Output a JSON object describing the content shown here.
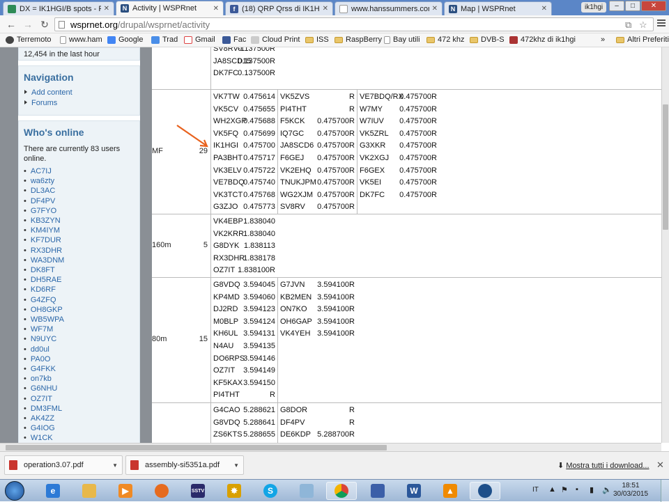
{
  "tabs": [
    {
      "title": "DX = IK1HGI/B spots - R",
      "favicon": "chart-favicon",
      "color": "#2e8b57",
      "active": false
    },
    {
      "title": "Activity | WSPRnet",
      "favicon": "n-favicon",
      "color": "#2b4f80",
      "active": true
    },
    {
      "title": "(18) QRP Qrss di IK1HGI",
      "favicon": "facebook-favicon",
      "color": "#3b5998",
      "active": false
    },
    {
      "title": "www.hanssummers.com/",
      "favicon": "page-favicon",
      "color": "#999999",
      "active": false
    },
    {
      "title": "Map | WSPRnet",
      "favicon": "n-favicon",
      "color": "#2b4f80",
      "active": false
    }
  ],
  "profile": "ik1hgi",
  "window_controls": {
    "minimize": "–",
    "maximize": "□",
    "close": "✕"
  },
  "url": {
    "host": "wsprnet.org",
    "path": "/drupal/wsprnet/activity"
  },
  "bookmarks": [
    {
      "label": "Terremoto",
      "icon": "app-icon"
    },
    {
      "label": "www.ham",
      "icon": "page-icon"
    },
    {
      "label": "Google",
      "icon": "google-icon"
    },
    {
      "label": "Trad",
      "icon": "translate-icon"
    },
    {
      "label": "Gmail",
      "icon": "gmail-icon"
    },
    {
      "label": "Fac",
      "icon": "facebook-icon"
    },
    {
      "label": "Cloud Print",
      "icon": "printer-icon"
    },
    {
      "label": "ISS",
      "icon": "folder-icon"
    },
    {
      "label": "RaspBerry",
      "icon": "folder-icon"
    },
    {
      "label": "Bay utili",
      "icon": "page-icon"
    },
    {
      "label": "472 khz",
      "icon": "folder-icon"
    },
    {
      "label": "DVB-S",
      "icon": "folder-icon"
    },
    {
      "label": "472khz di ik1hgi",
      "icon": "antenna-icon"
    }
  ],
  "bookmarks_more": "»",
  "other_bookmarks": "Altri Preferiti",
  "sidebar": {
    "stats_text": "12,454 in the last hour",
    "navigation": {
      "title": "Navigation",
      "items": [
        "Add content",
        "Forums"
      ]
    },
    "whos_online": {
      "title": "Who's online",
      "text": "There are currently 83 users online.",
      "users": [
        "AC7IJ",
        "wa6zty",
        "DL3AC",
        "DF4PV",
        "G7FYO",
        "KB3ZYN",
        "KM4IYM",
        "KF7DUR",
        "RX3DHR",
        "WA3DNM",
        "DK8FT",
        "DH5RAE",
        "KD6RF",
        "G4ZFQ",
        "OH8GKP",
        "WB5WPA",
        "WF7M",
        "N9UYC",
        "dd0ul",
        "PA0O",
        "G4FKK",
        "on7kb",
        "G6NHU",
        "OZ7IT",
        "DM3FML",
        "AK4ZZ",
        "G4IOG",
        "W1CK"
      ]
    }
  },
  "activity": {
    "top_partial": {
      "columns": [
        [
          [
            "SV8RV-1",
            "0.137500R"
          ],
          [
            "JA8SCD15",
            "0.137500R"
          ],
          [
            "DK7FC",
            "0.137500R"
          ]
        ]
      ]
    },
    "bands": [
      {
        "band": "MF",
        "count": "29",
        "columns": [
          [
            [
              "VK7TW",
              "0.475614"
            ],
            [
              "VK5CV",
              "0.475655"
            ],
            [
              "WH2XGP",
              "0.475688"
            ],
            [
              "VK5FQ",
              "0.475699"
            ],
            [
              "IK1HGI",
              "0.475700"
            ],
            [
              "PA3BHT",
              "0.475717"
            ],
            [
              "VK3ELV",
              "0.475722"
            ],
            [
              "VE7BDQ",
              "0.475740"
            ],
            [
              "VK3TCT",
              "0.475768"
            ],
            [
              "G3ZJO",
              "0.475773"
            ]
          ],
          [
            [
              "VK5ZVS",
              "R"
            ],
            [
              "PI4THT",
              "R"
            ],
            [
              "F5KCK",
              "0.475700R"
            ],
            [
              "IQ7GC",
              "0.475700R"
            ],
            [
              "JA8SCD6",
              "0.475700R"
            ],
            [
              "F6GEJ",
              "0.475700R"
            ],
            [
              "VK2EHQ",
              "0.475700R"
            ],
            [
              "TNUKJPM",
              "0.475700R"
            ],
            [
              "WG2XJM",
              "0.475700R"
            ],
            [
              "SV8RV",
              "0.475700R"
            ]
          ],
          [
            [
              "VE7BDQ/RX",
              "0.475700R"
            ],
            [
              "W7MY",
              "0.475700R"
            ],
            [
              "W7IUV",
              "0.475700R"
            ],
            [
              "VK5ZRL",
              "0.475700R"
            ],
            [
              "G3XKR",
              "0.475700R"
            ],
            [
              "VK2XGJ",
              "0.475700R"
            ],
            [
              "F6GEX",
              "0.475700R"
            ],
            [
              "VK5EI",
              "0.475700R"
            ],
            [
              "DK7FC",
              "0.475700R"
            ]
          ]
        ]
      },
      {
        "band": "160m",
        "count": "5",
        "columns": [
          [
            [
              "VK4EBP",
              "1.838040"
            ],
            [
              "VK2KRR",
              "1.838040"
            ],
            [
              "G8DYK",
              "1.838113"
            ],
            [
              "RX3DHR",
              "1.838178"
            ],
            [
              "OZ7IT",
              "1.838100R"
            ]
          ]
        ]
      },
      {
        "band": "80m",
        "count": "15",
        "columns": [
          [
            [
              "G8VDQ",
              "3.594045"
            ],
            [
              "KP4MD",
              "3.594060"
            ],
            [
              "DJ2RD",
              "3.594123"
            ],
            [
              "M0BLP",
              "3.594124"
            ],
            [
              "KH6UL",
              "3.594131"
            ],
            [
              "N4AU",
              "3.594135"
            ],
            [
              "DO6RPS",
              "3.594146"
            ],
            [
              "OZ7IT",
              "3.594149"
            ],
            [
              "KF5KAX",
              "3.594150"
            ],
            [
              "PI4THT",
              "R"
            ]
          ],
          [
            [
              "G7JVN",
              "3.594100R"
            ],
            [
              "KB2MEN",
              "3.594100R"
            ],
            [
              "ON7KO",
              "3.594100R"
            ],
            [
              "OH6GAP",
              "3.594100R"
            ],
            [
              "VK4YEH",
              "3.594100R"
            ]
          ]
        ]
      },
      {
        "band": "",
        "count": "",
        "columns": [
          [
            [
              "G4CAO",
              "5.288621"
            ],
            [
              "G8VDQ",
              "5.288641"
            ],
            [
              "ZS6KTS",
              "5.288655"
            ]
          ],
          [
            [
              "G8DOR",
              "R"
            ],
            [
              "DF4PV",
              "R"
            ],
            [
              "DE6KDP",
              "5.288700R"
            ]
          ]
        ]
      }
    ]
  },
  "downloads": [
    {
      "name": "operation3.07.pdf"
    },
    {
      "name": "assembly-si5351a.pdf"
    }
  ],
  "download_show_all": "Mostra tutti i download...",
  "taskbar": {
    "apps": [
      "internet-explorer-icon",
      "file-explorer-icon",
      "media-player-icon",
      "firefox-icon",
      "sstv-icon",
      "burst-app-icon",
      "skype-icon",
      "cube-app-icon",
      "chrome-icon",
      "save-disk-icon",
      "word-icon",
      "vlc-icon",
      "globe-icon"
    ],
    "language": "IT",
    "time": "18:51",
    "date": "30/03/2015"
  }
}
